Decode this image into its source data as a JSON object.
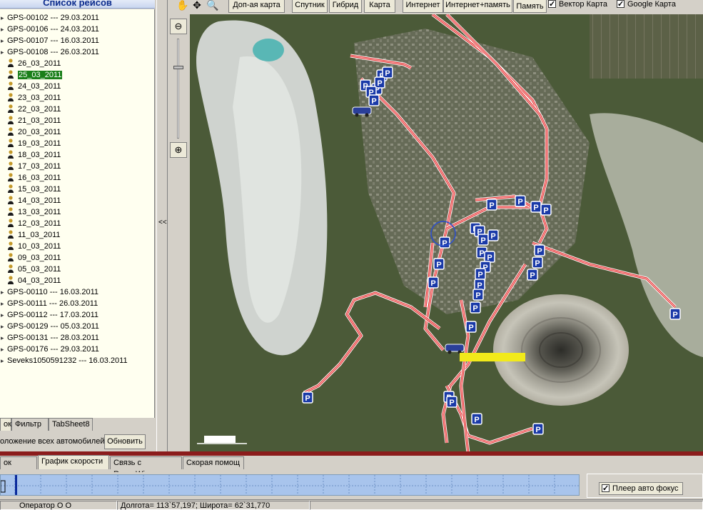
{
  "left_panel": {
    "title": "Список рейсов",
    "trips": [
      {
        "label": "GPS-00102 --- 29.03.2011",
        "level": 0,
        "selected": false
      },
      {
        "label": "GPS-00106 --- 24.03.2011",
        "level": 0,
        "selected": false
      },
      {
        "label": "GPS-00107 --- 16.03.2011",
        "level": 0,
        "selected": false
      },
      {
        "label": "GPS-00108 --- 26.03.2011",
        "level": 0,
        "selected": false
      },
      {
        "label": "26_03_2011",
        "level": 1,
        "selected": false
      },
      {
        "label": "25_03_2011",
        "level": 1,
        "selected": true
      },
      {
        "label": "24_03_2011",
        "level": 1,
        "selected": false
      },
      {
        "label": "23_03_2011",
        "level": 1,
        "selected": false
      },
      {
        "label": "22_03_2011",
        "level": 1,
        "selected": false
      },
      {
        "label": "21_03_2011",
        "level": 1,
        "selected": false
      },
      {
        "label": "20_03_2011",
        "level": 1,
        "selected": false
      },
      {
        "label": "19_03_2011",
        "level": 1,
        "selected": false
      },
      {
        "label": "18_03_2011",
        "level": 1,
        "selected": false
      },
      {
        "label": "17_03_2011",
        "level": 1,
        "selected": false
      },
      {
        "label": "16_03_2011",
        "level": 1,
        "selected": false
      },
      {
        "label": "15_03_2011",
        "level": 1,
        "selected": false
      },
      {
        "label": "14_03_2011",
        "level": 1,
        "selected": false
      },
      {
        "label": "13_03_2011",
        "level": 1,
        "selected": false
      },
      {
        "label": "12_03_2011",
        "level": 1,
        "selected": false
      },
      {
        "label": "11_03_2011",
        "level": 1,
        "selected": false
      },
      {
        "label": "10_03_2011",
        "level": 1,
        "selected": false
      },
      {
        "label": "09_03_2011",
        "level": 1,
        "selected": false
      },
      {
        "label": "05_03_2011",
        "level": 1,
        "selected": false
      },
      {
        "label": "04_03_2011",
        "level": 1,
        "selected": false
      },
      {
        "label": "GPS-00110 --- 16.03.2011",
        "level": 0,
        "selected": false
      },
      {
        "label": "GPS-00111 --- 26.03.2011",
        "level": 0,
        "selected": false
      },
      {
        "label": "GPS-00112 --- 17.03.2011",
        "level": 0,
        "selected": false
      },
      {
        "label": "GPS-00129 --- 05.03.2011",
        "level": 0,
        "selected": false
      },
      {
        "label": "GPS-00131 --- 28.03.2011",
        "level": 0,
        "selected": false
      },
      {
        "label": "GPS-00176 --- 29.03.2011",
        "level": 0,
        "selected": false
      },
      {
        "label": "Seveks1050591232 --- 16.03.2011",
        "level": 0,
        "selected": false
      }
    ],
    "tabs": [
      "ок",
      "Фильтр",
      "TabSheet8"
    ],
    "vehicles_label": "оложение всех автомобилей",
    "refresh_label": "Обновить"
  },
  "splitter_label": "<<",
  "toolbar": {
    "tool_icons": [
      "hand-icon",
      "move-icon",
      "magnifier-icon"
    ],
    "buttons": [
      "Доп-ая карта",
      "Спутник",
      "Гибрид",
      "Карта",
      "Интернет",
      "Интернет+память",
      "Память"
    ],
    "checks": [
      {
        "label": "Вектор Карта",
        "checked": true
      },
      {
        "label": "Google Карта",
        "checked": true
      }
    ]
  },
  "zoom": {
    "level_fraction": 0.72
  },
  "map": {
    "route_color": "#e02020",
    "marker_label": "P",
    "marker_color": "#1a3aa8"
  },
  "bottom": {
    "tabs": [
      "ок треков",
      "График скорости",
      "Связь с RussaWin",
      "Скорая помощ"
    ],
    "active_tab": 1,
    "autofocus_label": "Плеер авто фокус",
    "autofocus_checked": true
  },
  "status": {
    "operator": "Оператор О О",
    "coords": "Долгота= 113`57,197; Широта= 62`31,770"
  },
  "colors": {
    "selected_bg": "#1a7f1a",
    "header_text": "#0a2a8c",
    "divider": "#8b1c1c"
  }
}
